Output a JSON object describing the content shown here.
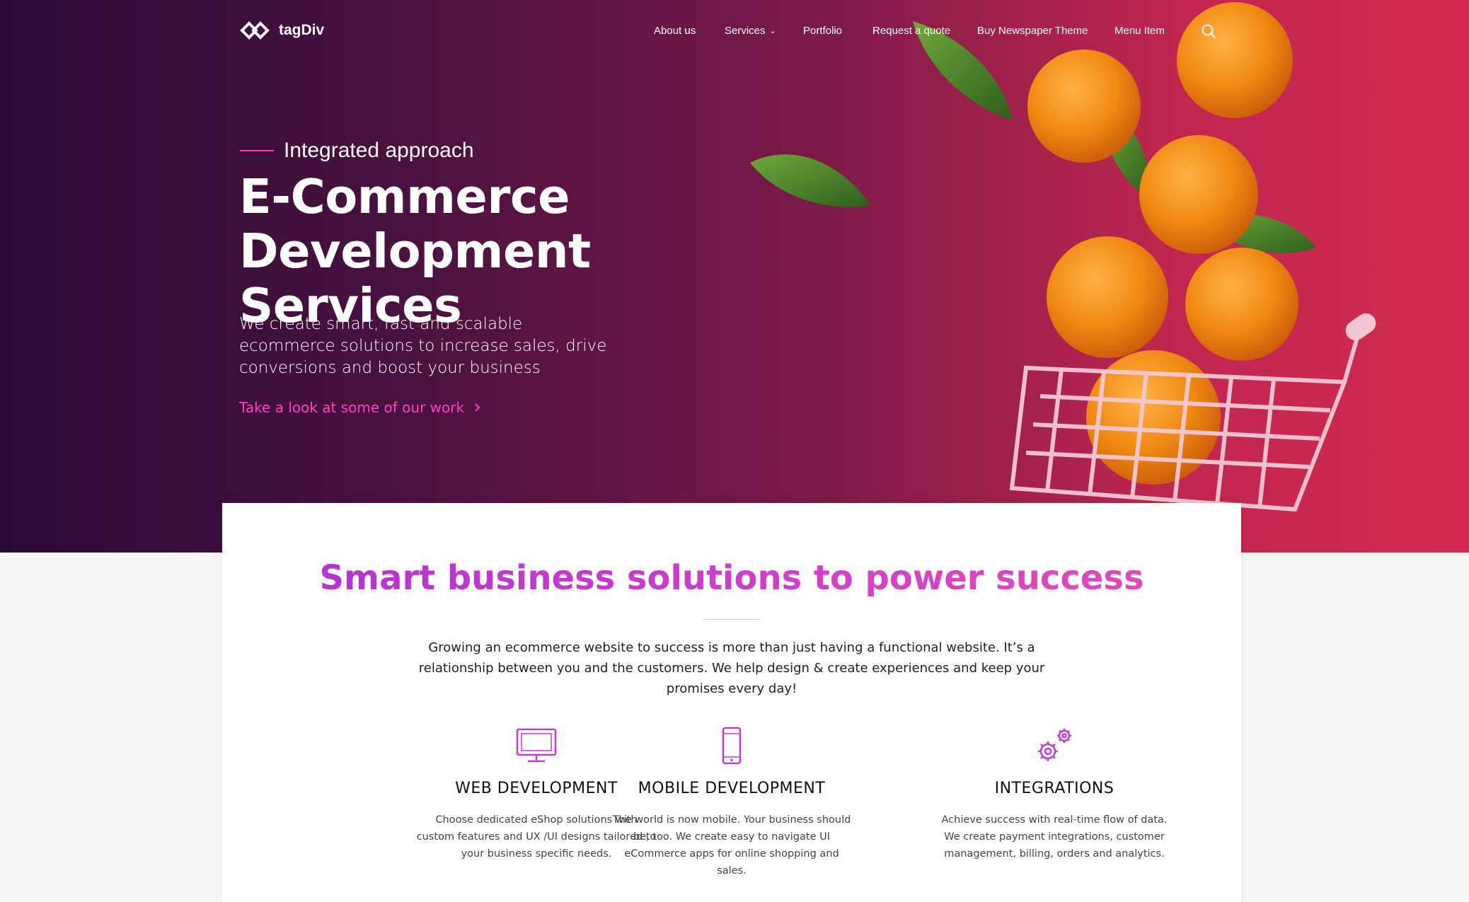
{
  "brand": {
    "name": "tagDiv"
  },
  "nav": {
    "items": [
      {
        "label": "About us"
      },
      {
        "label": "Services"
      },
      {
        "label": "Portfolio"
      },
      {
        "label": "Request a quote"
      },
      {
        "label": "Buy Newspaper Theme"
      },
      {
        "label": "Menu Item"
      }
    ],
    "search_icon": "search-icon",
    "dropdown_icon": "chevron-down-icon"
  },
  "hero": {
    "kicker": "Integrated approach",
    "title_line1": "E-Commerce",
    "title_line2": "Development Services",
    "description": "We create smart, fast and scalable ecommerce solutions to increase sales, drive conversions and boost your business",
    "link_label": "Take a look at some of our work",
    "link_icon": "chevron-right-icon"
  },
  "intro": {
    "title": "Smart business solutions to power success",
    "text": "Growing an ecommerce website to success is more than just having a functional website. It’s a relationship between you and the customers. We help design & create experiences and keep your promises every day!"
  },
  "features": [
    {
      "icon": "monitor-icon",
      "title": "WEB DEVELOPMENT",
      "text": "Choose dedicated eShop solutions with custom features and UX /UI designs tailored to your business specific needs."
    },
    {
      "icon": "smartphone-icon",
      "title": "MOBILE DEVELOPMENT",
      "text": "The world is now mobile. Your business should be, too. We create easy to navigate UI eCommerce apps for online shopping and sales."
    },
    {
      "icon": "gears-icon",
      "title": "INTEGRATIONS",
      "text": "Achieve success with real-time flow of data. We create payment integrations, customer management, billing, orders and analytics."
    }
  ],
  "colors": {
    "accent": "#d03ccf",
    "link": "#ff3ec0",
    "hero_dark": "#2a0a33",
    "hero_light": "#d42a52"
  }
}
